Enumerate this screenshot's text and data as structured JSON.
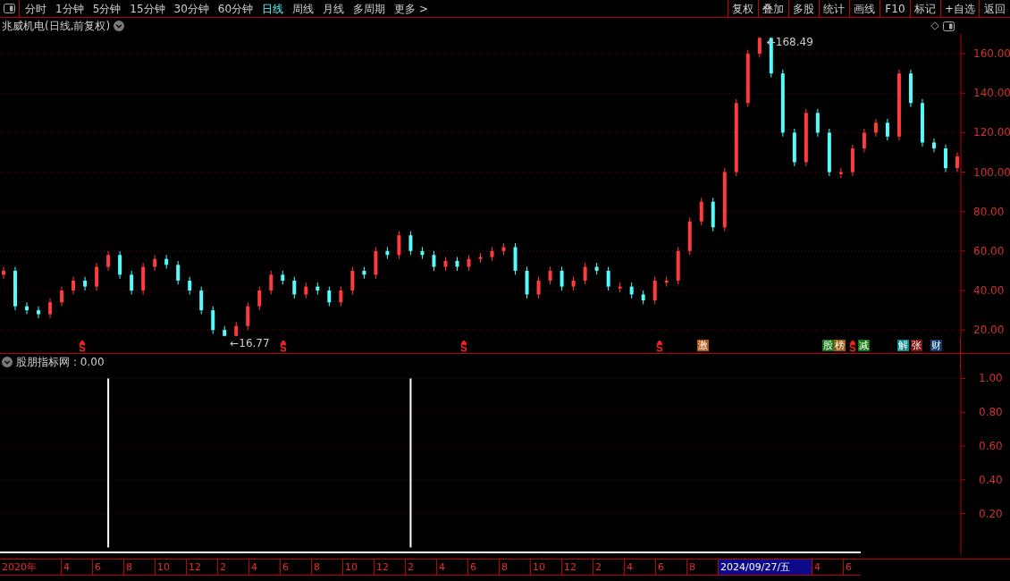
{
  "toolbar": {
    "periods": [
      {
        "label": "分时",
        "selected": false
      },
      {
        "label": "1分钟",
        "selected": false
      },
      {
        "label": "5分钟",
        "selected": false
      },
      {
        "label": "15分钟",
        "selected": false
      },
      {
        "label": "30分钟",
        "selected": false
      },
      {
        "label": "60分钟",
        "selected": false
      },
      {
        "label": "日线",
        "selected": true
      },
      {
        "label": "周线",
        "selected": false
      },
      {
        "label": "月线",
        "selected": false
      },
      {
        "label": "多周期",
        "selected": false
      },
      {
        "label": "更多 >",
        "selected": false
      }
    ],
    "buttons": [
      "复权",
      "叠加",
      "多股",
      "统计",
      "画线",
      "F10",
      "标记",
      "+自选",
      "返回"
    ]
  },
  "price_panel": {
    "title": "兆威机电(日线,前复权)",
    "chart_data": {
      "type": "candlestick",
      "grid": true,
      "ylim": [
        16,
        170
      ],
      "yticks": [
        {
          "value": 20,
          "label": "20.00"
        },
        {
          "value": 40,
          "label": "40.00"
        },
        {
          "value": 60,
          "label": "60.00"
        },
        {
          "value": 80,
          "label": "80.00"
        },
        {
          "value": 100,
          "label": "100.00"
        },
        {
          "value": 120,
          "label": "120.00"
        },
        {
          "value": 140,
          "label": "140.00"
        },
        {
          "value": 160,
          "label": "160.00"
        }
      ],
      "categories": [
        null,
        null,
        null,
        null,
        null,
        null,
        null,
        null,
        null,
        null,
        null,
        null,
        null,
        null,
        null,
        null,
        null,
        null,
        null,
        null,
        null,
        null,
        null,
        null,
        null,
        null,
        null,
        null,
        null,
        null,
        null,
        null,
        null,
        null,
        null,
        null,
        null,
        null,
        null,
        null,
        null,
        null,
        null,
        null,
        null,
        null,
        null,
        null,
        null,
        null,
        null,
        null,
        null,
        null,
        null,
        null,
        null,
        null,
        null,
        null,
        null,
        null,
        null,
        null,
        null,
        null,
        null,
        null,
        null,
        null,
        null,
        null,
        null,
        null,
        null,
        null,
        null,
        null,
        null,
        null,
        null,
        null,
        null
      ],
      "ohlc": [
        [
          48,
          52,
          46,
          50
        ],
        [
          50,
          52,
          30,
          32
        ],
        [
          32,
          34,
          28,
          30
        ],
        [
          30,
          32,
          26,
          28
        ],
        [
          28,
          36,
          26,
          34
        ],
        [
          34,
          42,
          32,
          40
        ],
        [
          40,
          47,
          38,
          45
        ],
        [
          45,
          47,
          40,
          42
        ],
        [
          42,
          54,
          40,
          52
        ],
        [
          52,
          60,
          50,
          58
        ],
        [
          58,
          60,
          46,
          48
        ],
        [
          48,
          50,
          38,
          40
        ],
        [
          40,
          54,
          38,
          52
        ],
        [
          52,
          58,
          50,
          56
        ],
        [
          56,
          58,
          51,
          53
        ],
        [
          53,
          55,
          43,
          45
        ],
        [
          45,
          47,
          38,
          40
        ],
        [
          40,
          42,
          28,
          30
        ],
        [
          30,
          32,
          18,
          20
        ],
        [
          20,
          22,
          16.77,
          17
        ],
        [
          17,
          24,
          16.9,
          22
        ],
        [
          22,
          34,
          20,
          32
        ],
        [
          32,
          42,
          30,
          40
        ],
        [
          40,
          50,
          38,
          48
        ],
        [
          48,
          50,
          43,
          45
        ],
        [
          45,
          47,
          36,
          38
        ],
        [
          38,
          44,
          36,
          42
        ],
        [
          42,
          44,
          38,
          40
        ],
        [
          40,
          42,
          32,
          34
        ],
        [
          34,
          42,
          32,
          40
        ],
        [
          40,
          52,
          38,
          50
        ],
        [
          50,
          52,
          46,
          48
        ],
        [
          48,
          62,
          46,
          60
        ],
        [
          60,
          62,
          56,
          58
        ],
        [
          58,
          70,
          56,
          68
        ],
        [
          68,
          70,
          58,
          60
        ],
        [
          60,
          62,
          56,
          58
        ],
        [
          58,
          60,
          50,
          52
        ],
        [
          52,
          57,
          50,
          55
        ],
        [
          55,
          57,
          50,
          52
        ],
        [
          52,
          58,
          50,
          56
        ],
        [
          56,
          59,
          54,
          57
        ],
        [
          57,
          62,
          55,
          60
        ],
        [
          60,
          64,
          58,
          62
        ],
        [
          62,
          64,
          48,
          50
        ],
        [
          50,
          52,
          36,
          38
        ],
        [
          38,
          47,
          36,
          45
        ],
        [
          45,
          52,
          43,
          50
        ],
        [
          50,
          52,
          40,
          42
        ],
        [
          42,
          47,
          40,
          45
        ],
        [
          45,
          54,
          43,
          52
        ],
        [
          52,
          54,
          48,
          50
        ],
        [
          50,
          52,
          40,
          42
        ],
        [
          41,
          44,
          39,
          42
        ],
        [
          42,
          44,
          36,
          38
        ],
        [
          38,
          40,
          33,
          35
        ],
        [
          35,
          47,
          33,
          45
        ],
        [
          44,
          47,
          42,
          45
        ],
        [
          45,
          62,
          43,
          60
        ],
        [
          60,
          77,
          58,
          75
        ],
        [
          75,
          87,
          73,
          85
        ],
        [
          85,
          87,
          70,
          72
        ],
        [
          72,
          102,
          70,
          100
        ],
        [
          100,
          137,
          98,
          135
        ],
        [
          135,
          162,
          133,
          160
        ],
        [
          160,
          168.49,
          158,
          168
        ],
        [
          168,
          168.2,
          148,
          150
        ],
        [
          150,
          152,
          118,
          120
        ],
        [
          120,
          122,
          103,
          105
        ],
        [
          105,
          132,
          103,
          130
        ],
        [
          130,
          132,
          118,
          120
        ],
        [
          120,
          122,
          98,
          100
        ],
        [
          99,
          102,
          97,
          100
        ],
        [
          100,
          114,
          98,
          112
        ],
        [
          112,
          122,
          110,
          120
        ],
        [
          120,
          127,
          118,
          125
        ],
        [
          125,
          127,
          116,
          118
        ],
        [
          118,
          152,
          116,
          150
        ],
        [
          150,
          152,
          133,
          135
        ],
        [
          135,
          137,
          113,
          115
        ],
        [
          115,
          117,
          110,
          112
        ],
        [
          112,
          114,
          100,
          102
        ],
        [
          102,
          110,
          100,
          108
        ]
      ],
      "annotations": [
        "←168.49",
        "←16.77"
      ]
    },
    "markers": [
      {
        "kind": "signal",
        "color": "#ff2020"
      },
      {
        "kind": "signal",
        "color": "#ff2020"
      },
      {
        "kind": "signal",
        "color": "#ff2020"
      },
      {
        "kind": "signal",
        "color": "#ff2020"
      },
      {
        "kind": "badge",
        "text": "激",
        "color": "#b05a18"
      },
      {
        "kind": "badge",
        "text": "股",
        "color": "#137a13"
      },
      {
        "kind": "badge",
        "text": "榜",
        "color": "#9a5a10"
      },
      {
        "kind": "signal",
        "color": "#ff2020"
      },
      {
        "kind": "badge",
        "text": "减",
        "color": "#137a13"
      },
      {
        "kind": "badge",
        "text": "解",
        "color": "#0f8a8a"
      },
      {
        "kind": "badge",
        "text": "张",
        "color": "#7a1010"
      },
      {
        "kind": "badge",
        "text": "财",
        "color": "#103a70"
      }
    ]
  },
  "indicator_panel": {
    "title": "股朋指标网",
    "value": ": 0.00",
    "chart_data": {
      "type": "bar",
      "grid": true,
      "ylim": [
        -0.04,
        1.05
      ],
      "categories": [
        null,
        null,
        null,
        null,
        null,
        null,
        null,
        null,
        null,
        null,
        null,
        null,
        null,
        null,
        null,
        null,
        null,
        null,
        null,
        null,
        null,
        null,
        null,
        null,
        null,
        null,
        null,
        null,
        null,
        null,
        null,
        null,
        null,
        null,
        null,
        null,
        null,
        null,
        null,
        null,
        null,
        null,
        null,
        null,
        null,
        null,
        null,
        null,
        null,
        null,
        null,
        null,
        null,
        null,
        null,
        null,
        null,
        null,
        null,
        null,
        null,
        null,
        null,
        null,
        null,
        null,
        null,
        null,
        null,
        null,
        null,
        null,
        null,
        null,
        null,
        null,
        null,
        null,
        null,
        null,
        null,
        null,
        null
      ],
      "values": [
        0,
        0,
        0,
        0,
        0,
        0,
        0,
        0,
        0,
        1,
        0,
        0,
        0,
        0,
        0,
        0,
        0,
        0,
        0,
        0,
        0,
        0,
        0,
        0,
        0,
        0,
        0,
        0,
        0,
        0,
        0,
        0,
        0,
        0,
        0,
        1,
        0,
        0,
        0,
        0,
        0,
        0,
        0,
        0,
        0,
        0,
        0,
        0,
        0,
        0,
        0,
        0,
        0,
        0,
        0,
        0,
        0,
        0,
        0,
        0,
        0,
        0,
        0,
        0,
        0,
        0,
        0,
        0,
        0,
        0,
        0,
        0,
        0,
        0,
        0,
        0,
        0,
        0,
        0,
        0,
        0,
        0,
        0
      ],
      "yticks": [
        {
          "value": 0.2,
          "label": "0.20"
        },
        {
          "value": 0.4,
          "label": "0.40"
        },
        {
          "value": 0.6,
          "label": "0.60"
        },
        {
          "value": 0.8,
          "label": "0.80"
        },
        {
          "value": 1,
          "label": "1.00"
        }
      ]
    }
  },
  "time_axis": [
    {
      "label": "2020年",
      "selected": false
    },
    {
      "label": "4",
      "selected": false
    },
    {
      "label": "6",
      "selected": false
    },
    {
      "label": "8",
      "selected": false
    },
    {
      "label": "10",
      "selected": false
    },
    {
      "label": "12",
      "selected": false
    },
    {
      "label": "2",
      "selected": false
    },
    {
      "label": "4",
      "selected": false
    },
    {
      "label": "6",
      "selected": false
    },
    {
      "label": "8",
      "selected": false
    },
    {
      "label": "10",
      "selected": false
    },
    {
      "label": "12",
      "selected": false
    },
    {
      "label": "2",
      "selected": false
    },
    {
      "label": "4",
      "selected": false
    },
    {
      "label": "6",
      "selected": false
    },
    {
      "label": "8",
      "selected": false
    },
    {
      "label": "10",
      "selected": false
    },
    {
      "label": "12",
      "selected": false
    },
    {
      "label": "2",
      "selected": false
    },
    {
      "label": "4",
      "selected": false
    },
    {
      "label": "6",
      "selected": false
    },
    {
      "label": "8",
      "selected": false
    },
    {
      "label": "2024/09/27/五",
      "selected": true
    },
    {
      "label": "4",
      "selected": false
    },
    {
      "label": "6",
      "selected": false
    }
  ]
}
